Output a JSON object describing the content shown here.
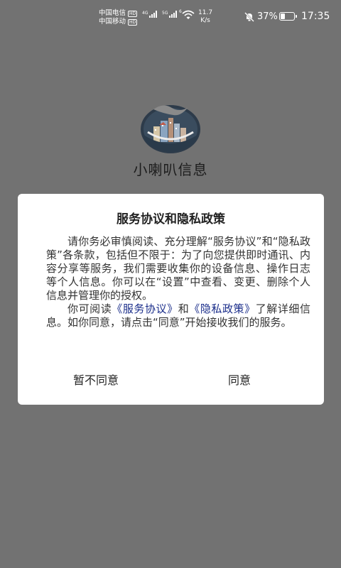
{
  "status_bar": {
    "carrier_1": "中国电信",
    "carrier_2": "中国移动",
    "hd_badge": "HD",
    "network_1": "4G",
    "network_2": "5G",
    "wifi_tag": "6",
    "speed_value": "11.7",
    "speed_unit": "K/s",
    "battery_percent": "37%",
    "battery_level": 0.37,
    "time": "17:35",
    "icons": [
      "signal-icon",
      "wifi-icon",
      "mute-icon",
      "battery-icon"
    ]
  },
  "app": {
    "name": "小喇叭信息",
    "logo_icon": "app-logo-icon"
  },
  "dialog": {
    "title": "服务协议和隐私政策",
    "paragraph1": "请你务必审慎阅读、充分理解“服务协议”和“隐私政策”各条款，包括但不限于：为了向您提供即时通讯、内容分享等服务，我们需要收集你的设备信息、操作日志等个人信息。你可以在“设置”中查看、变更、删除个人信息并管理你的授权。",
    "p2_prefix": "你可阅读",
    "link_service": "《服务协议》",
    "p2_and": "和",
    "link_privacy": "《隐私政策》",
    "p2_suffix": "了解详细信息。如你同意，请点击“同意”开始接收我们的服务。",
    "disagree_label": "暂不同意",
    "agree_label": "同意",
    "link_color": "#1a2d8a"
  }
}
